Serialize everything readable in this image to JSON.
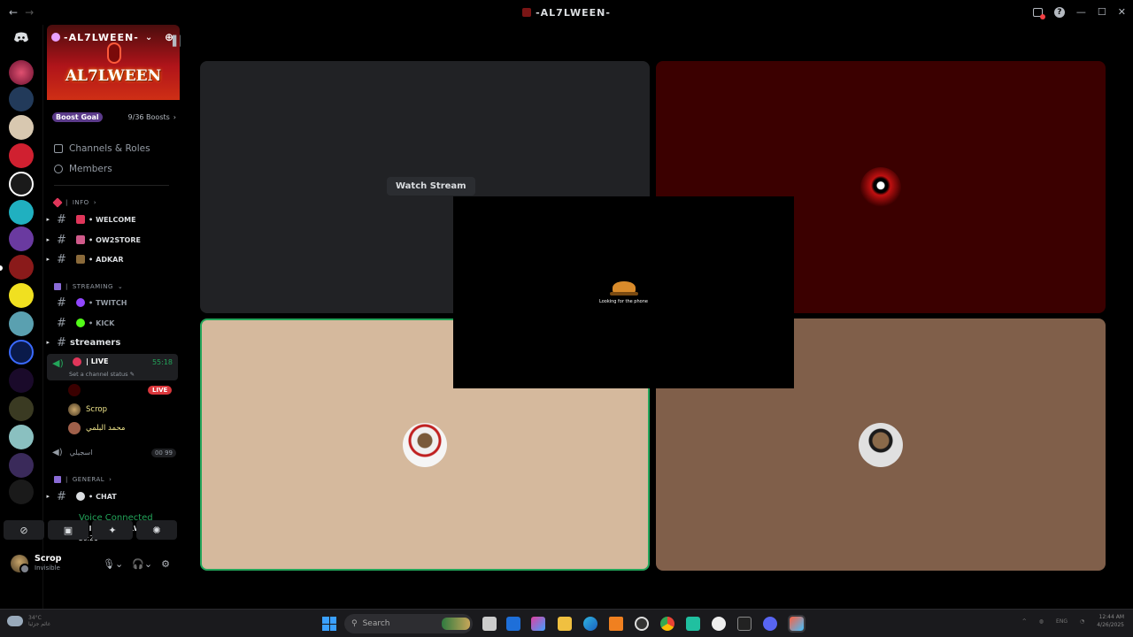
{
  "window": {
    "title": "-AL7LWEEN-",
    "nav_back": "←",
    "nav_forward": "→",
    "help": "?",
    "minimize": "—",
    "maximize": "☐",
    "close": "✕"
  },
  "server": {
    "name": "-AL7LWEEN-",
    "banner_logo": "AL7LWEEN",
    "boost_label": "Boost Goal",
    "boost_count": "9/36 Boosts",
    "menu": [
      "Channels & Roles",
      "Members"
    ]
  },
  "channels": {
    "cat_info": "INFO",
    "welcome": "WELCOME",
    "store": "OW2STORE",
    "adkar": "ADKAR",
    "cat_streaming": "STREAMING",
    "twitch": "TWITCH",
    "kick": "KICK",
    "streamers": "streamers",
    "live_channel": "| LIVE",
    "live_time": "55:18",
    "live_status": "Set a channel status",
    "live_badge": "LIVE",
    "voice_users": [
      "Scrop",
      "محمد البلمي"
    ],
    "voice2": "اسجيلي",
    "voice2_count": "00 99",
    "cat_general": "GENERAL",
    "chat": "CHAT"
  },
  "voice_panel": {
    "status": "Voice Connected",
    "channel": "| LIVE / -AL7LWEE...",
    "time": "26:21"
  },
  "user": {
    "name": "Scrop",
    "status": "Invisible"
  },
  "stage": {
    "watch_stream": "Watch Stream",
    "popup_text": "Looking for the phone",
    "tile_colors": [
      "#212225",
      "#3b0000",
      "#d5b99d",
      "#805f4a"
    ]
  },
  "taskbar": {
    "search_placeholder": "Search",
    "weather_temp": "34°C",
    "weather_desc": "غائم جزئيا",
    "lang": "ENG",
    "time": "12:44 AM",
    "date": "4/26/2025"
  }
}
